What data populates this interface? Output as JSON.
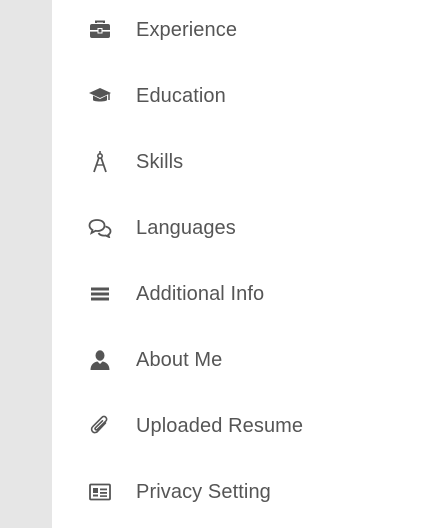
{
  "menu": {
    "items": [
      {
        "label": "Experience",
        "icon": "briefcase-icon"
      },
      {
        "label": "Education",
        "icon": "graduation-cap-icon"
      },
      {
        "label": "Skills",
        "icon": "compass-icon"
      },
      {
        "label": "Languages",
        "icon": "chat-bubbles-icon"
      },
      {
        "label": "Additional Info",
        "icon": "list-icon"
      },
      {
        "label": "About Me",
        "icon": "user-icon"
      },
      {
        "label": "Uploaded Resume",
        "icon": "paperclip-icon"
      },
      {
        "label": "Privacy Setting",
        "icon": "id-card-icon"
      }
    ]
  },
  "colors": {
    "sidebar_strip": "#e6e6e6",
    "text": "#555555",
    "icon": "#555555"
  }
}
